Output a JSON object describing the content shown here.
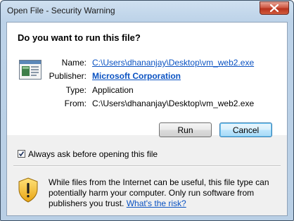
{
  "window": {
    "title": "Open File - Security Warning"
  },
  "dialog": {
    "question": "Do you want to run this file?",
    "fields": {
      "name_label": "Name:",
      "name_value": "C:\\Users\\dhananjay\\Desktop\\vm_web2.exe",
      "publisher_label": "Publisher:",
      "publisher_value": "Microsoft Corporation",
      "type_label": "Type:",
      "type_value": "Application",
      "from_label": "From:",
      "from_value": "C:\\Users\\dhananjay\\Desktop\\vm_web2.exe"
    },
    "buttons": {
      "run": "Run",
      "cancel": "Cancel"
    },
    "checkbox": {
      "label": "Always ask before opening this file",
      "checked": true
    },
    "warning": {
      "text": "While files from the Internet can be useful, this file type can potentially harm your computer. Only run software from publishers you trust.",
      "link": "What's the risk?"
    }
  },
  "icons": {
    "close": "close-icon",
    "file": "application-file-icon",
    "warning": "warning-shield-icon",
    "check": "check-icon"
  },
  "colors": {
    "link": "#0a52c2",
    "close_button": "#c9482f",
    "titlebar": "#bcd2e8"
  }
}
